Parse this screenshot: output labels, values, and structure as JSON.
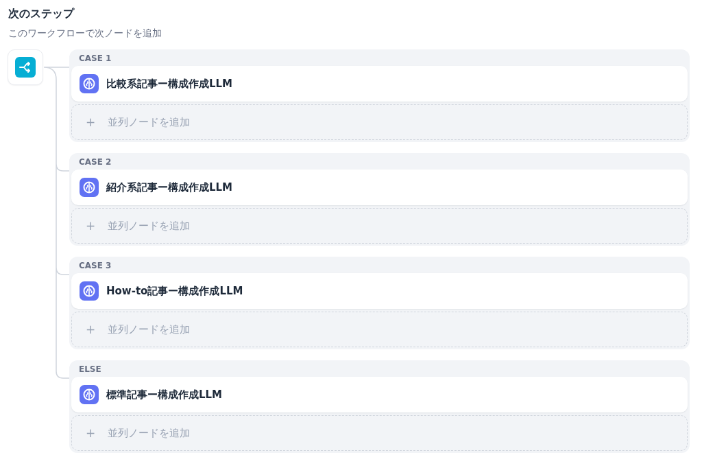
{
  "header": {
    "title": "次のステップ",
    "subtitle": "このワークフローで次ノードを追加"
  },
  "branches": [
    {
      "label": "CASE 1",
      "node": "比較系記事ー構成作成LLM",
      "add": "並列ノードを追加",
      "add_icon": "+"
    },
    {
      "label": "CASE 2",
      "node": "紹介系記事ー構成作成LLM",
      "add": "並列ノードを追加",
      "add_icon": "+"
    },
    {
      "label": "CASE 3",
      "node": "How-to記事ー構成作成LLM",
      "add": "並列ノードを追加",
      "add_icon": "+"
    },
    {
      "label": "ELSE",
      "node": "標準記事ー構成作成LLM",
      "add": "並列ノードを追加",
      "add_icon": "+"
    }
  ]
}
